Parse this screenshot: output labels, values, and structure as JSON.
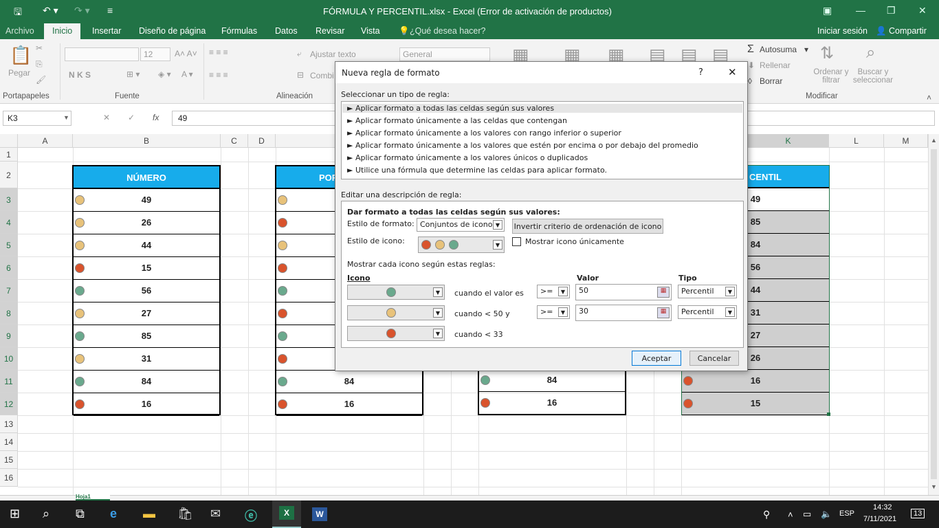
{
  "window": {
    "title": "FÓRMULA Y PERCENTIL.xlsx - Excel (Error de activación de productos)"
  },
  "tabs": {
    "archivo": "Archivo",
    "items": [
      "Inicio",
      "Insertar",
      "Diseño de página",
      "Fórmulas",
      "Datos",
      "Revisar",
      "Vista"
    ],
    "tell_me": "¿Qué desea hacer?",
    "signin": "Iniciar sesión",
    "share": "Compartir"
  },
  "ribbon": {
    "pegar": "Pegar",
    "font_size": "12",
    "font_buttons": "N  K  S",
    "ajustar": "Ajustar texto",
    "combinar": "Combi",
    "format": "General",
    "autosuma": "Autosuma",
    "rellenar": "Rellenar",
    "borrar": "Borrar",
    "ordenar": "Ordenar y filtrar",
    "buscar": "Buscar y seleccionar",
    "groups": {
      "portapapeles": "Portapapeles",
      "fuente": "Fuente",
      "alineacion": "Alineación",
      "modificar": "Modificar"
    }
  },
  "formula_bar": {
    "name_box": "K3",
    "fx": "fx",
    "value": "49"
  },
  "columns": [
    "A",
    "B",
    "C",
    "D",
    "K",
    "L",
    "M"
  ],
  "rows": [
    "1",
    "2",
    "3",
    "4",
    "5",
    "6",
    "7",
    "8",
    "9",
    "10",
    "11",
    "12",
    "13",
    "14",
    "15",
    "16"
  ],
  "table_b": {
    "header": "NÚMERO",
    "values": [
      "49",
      "26",
      "44",
      "15",
      "56",
      "27",
      "85",
      "31",
      "84",
      "16"
    ],
    "icons": [
      "yel",
      "yel",
      "yel",
      "red",
      "grn",
      "yel",
      "grn",
      "yel",
      "grn",
      "red"
    ]
  },
  "table_d": {
    "header": "POR",
    "visible_values": [
      "84",
      "16"
    ],
    "icons": [
      "yel",
      "red",
      "yel",
      "red",
      "grn",
      "red",
      "grn",
      "red",
      "grn",
      "red"
    ]
  },
  "table_g": {
    "visible_values": [
      "84",
      "16"
    ],
    "icons": [
      "grn",
      "red"
    ]
  },
  "table_k": {
    "header": "CENTIL",
    "values": [
      "49",
      "85",
      "84",
      "56",
      "44",
      "31",
      "27",
      "26",
      "16",
      "15"
    ],
    "visible_icons": [
      "red",
      "red"
    ]
  },
  "dialog": {
    "title": "Nueva regla de formato",
    "help": "?",
    "select_label": "Seleccionar un tipo de regla:",
    "rule_types": [
      "► Aplicar formato a todas las celdas según sus valores",
      "► Aplicar formato únicamente a las celdas que contengan",
      "► Aplicar formato únicamente a los valores con rango inferior o superior",
      "► Aplicar formato únicamente a los valores que estén por encima o por debajo del promedio",
      "► Aplicar formato únicamente a los valores únicos o duplicados",
      "► Utilice una fórmula que determine las celdas para aplicar formato."
    ],
    "edit_label": "Editar una descripción de regla:",
    "desc_title": "Dar formato a todas las celdas según sus valores:",
    "format_style_label": "Estilo de formato:",
    "format_style_value": "Conjuntos de iconos",
    "reverse_button": "Invertir criterio de ordenación de icono",
    "icon_style_label": "Estilo de icono:",
    "show_icon_only": "Mostrar icono únicamente",
    "rules_label": "Mostrar cada icono según estas reglas:",
    "col_icon": "Icono",
    "col_value": "Valor",
    "col_type": "Tipo",
    "rules": [
      {
        "icon": "grn",
        "condition": "cuando el valor es",
        "op": ">=",
        "value": "50",
        "type": "Percentil"
      },
      {
        "icon": "yel",
        "condition": "cuando < 50 y",
        "op": ">=",
        "value": "30",
        "type": "Percentil"
      },
      {
        "icon": "red",
        "condition": "cuando < 33"
      }
    ],
    "ok": "Aceptar",
    "cancel": "Cancelar"
  },
  "taskbar": {
    "lang": "ESP",
    "time": "14:32",
    "date": "7/11/2021",
    "notif": "13"
  },
  "sheet_tab": "Hoja1"
}
